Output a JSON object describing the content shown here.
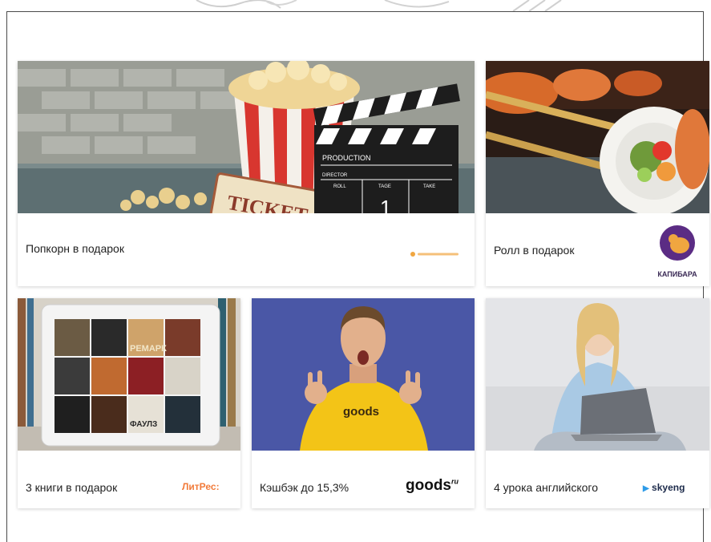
{
  "cards": [
    {
      "title": "Попкорн в подарок",
      "logo_text": "",
      "ticket_text": "TICKET",
      "clapper_text": "PRODUCTION",
      "clapper_fields": [
        "DIRECTOR",
        "ROLL",
        "TAGE",
        "TAKE"
      ],
      "clapper_number": "1"
    },
    {
      "title": "Ролл в подарок",
      "logo_text": "КАПИБАРА"
    },
    {
      "title": "3 книги в подарок",
      "logo_text": "ЛитРес:",
      "book_label_1": "РЕМАРК",
      "book_label_2": "ФАУЛЗ"
    },
    {
      "title": "Кэшбэк до 15,3%",
      "logo_text": "goods",
      "logo_suffix": "ru",
      "shirt_text": "goods"
    },
    {
      "title": "4 урока английского",
      "logo_text": "skyeng"
    }
  ],
  "colors": {
    "accent_orange": "#f0a640",
    "capybara_purple": "#5b2c84",
    "goods_blue": "#4a57a6",
    "goods_yellow": "#f3c417"
  }
}
